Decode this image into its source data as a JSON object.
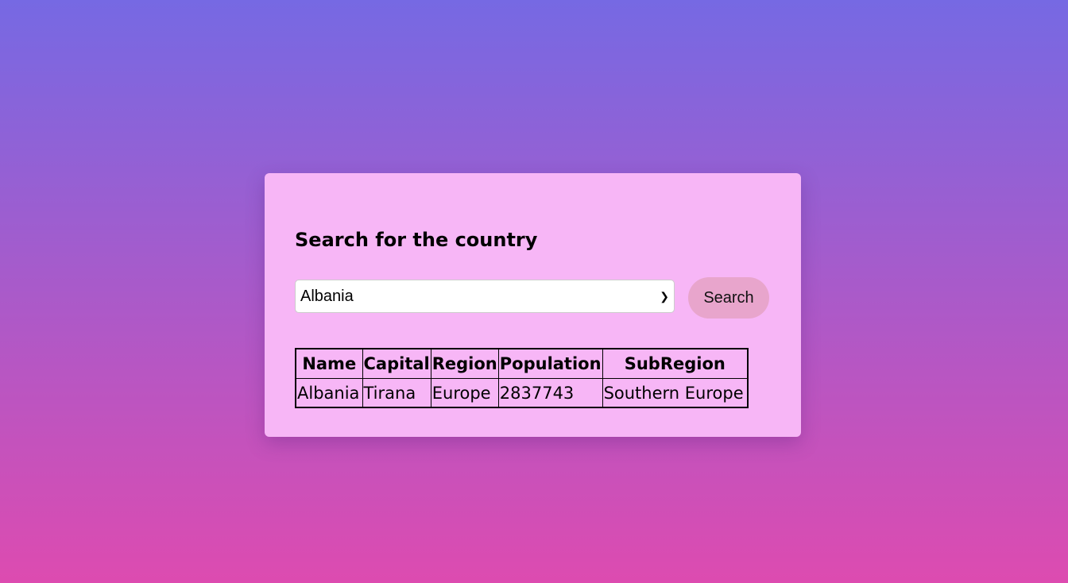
{
  "title": "Search for the country",
  "select": {
    "value": "Albania"
  },
  "search_label": "Search",
  "table": {
    "headers": [
      "Name",
      "Capital",
      "Region",
      "Population",
      "SubRegion"
    ],
    "rows": [
      [
        "Albania",
        "Tirana",
        "Europe",
        "2837743",
        "Southern Europe"
      ]
    ]
  }
}
